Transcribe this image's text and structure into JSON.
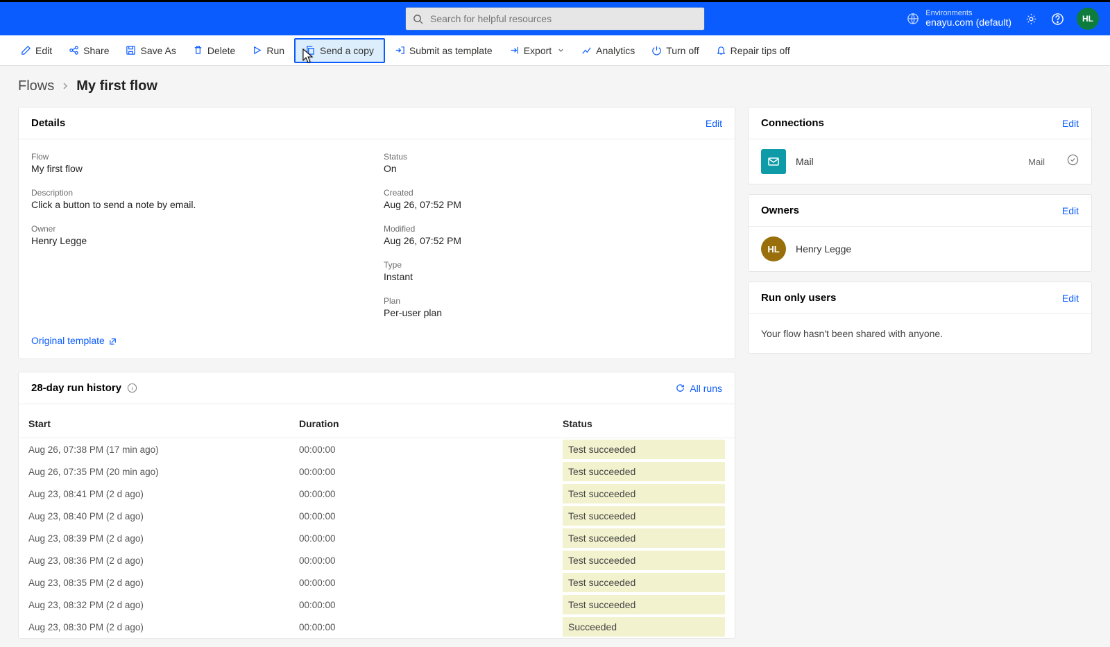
{
  "topbar": {
    "search_placeholder": "Search for helpful resources",
    "env_label": "Environments",
    "env_value": "enayu.com (default)",
    "user_initials": "HL"
  },
  "commands": {
    "edit": "Edit",
    "share": "Share",
    "saveas": "Save As",
    "delete": "Delete",
    "run": "Run",
    "sendcopy": "Send a copy",
    "submit": "Submit as template",
    "export": "Export",
    "analytics": "Analytics",
    "turnoff": "Turn off",
    "repair": "Repair tips off"
  },
  "breadcrumb": {
    "parent": "Flows",
    "current": "My first flow"
  },
  "details": {
    "title": "Details",
    "edit": "Edit",
    "flow_label": "Flow",
    "flow_value": "My first flow",
    "desc_label": "Description",
    "desc_value": "Click a button to send a note by email.",
    "owner_label": "Owner",
    "owner_value": "Henry Legge",
    "status_label": "Status",
    "status_value": "On",
    "created_label": "Created",
    "created_value": "Aug 26, 07:52 PM",
    "modified_label": "Modified",
    "modified_value": "Aug 26, 07:52 PM",
    "type_label": "Type",
    "type_value": "Instant",
    "plan_label": "Plan",
    "plan_value": "Per-user plan",
    "orig_link": "Original template"
  },
  "history": {
    "title": "28-day run history",
    "all_runs": "All runs",
    "col_start": "Start",
    "col_dur": "Duration",
    "col_status": "Status",
    "rows": [
      {
        "start": "Aug 26, 07:38 PM (17 min ago)",
        "dur": "00:00:00",
        "status": "Test succeeded"
      },
      {
        "start": "Aug 26, 07:35 PM (20 min ago)",
        "dur": "00:00:00",
        "status": "Test succeeded"
      },
      {
        "start": "Aug 23, 08:41 PM (2 d ago)",
        "dur": "00:00:00",
        "status": "Test succeeded"
      },
      {
        "start": "Aug 23, 08:40 PM (2 d ago)",
        "dur": "00:00:00",
        "status": "Test succeeded"
      },
      {
        "start": "Aug 23, 08:39 PM (2 d ago)",
        "dur": "00:00:00",
        "status": "Test succeeded"
      },
      {
        "start": "Aug 23, 08:36 PM (2 d ago)",
        "dur": "00:00:00",
        "status": "Test succeeded"
      },
      {
        "start": "Aug 23, 08:35 PM (2 d ago)",
        "dur": "00:00:00",
        "status": "Test succeeded"
      },
      {
        "start": "Aug 23, 08:32 PM (2 d ago)",
        "dur": "00:00:00",
        "status": "Test succeeded"
      },
      {
        "start": "Aug 23, 08:30 PM (2 d ago)",
        "dur": "00:00:00",
        "status": "Succeeded"
      }
    ]
  },
  "connections": {
    "title": "Connections",
    "edit": "Edit",
    "name": "Mail",
    "sub": "Mail"
  },
  "owners": {
    "title": "Owners",
    "edit": "Edit",
    "initials": "HL",
    "name": "Henry Legge"
  },
  "runonly": {
    "title": "Run only users",
    "edit": "Edit",
    "text": "Your flow hasn't been shared with anyone."
  }
}
